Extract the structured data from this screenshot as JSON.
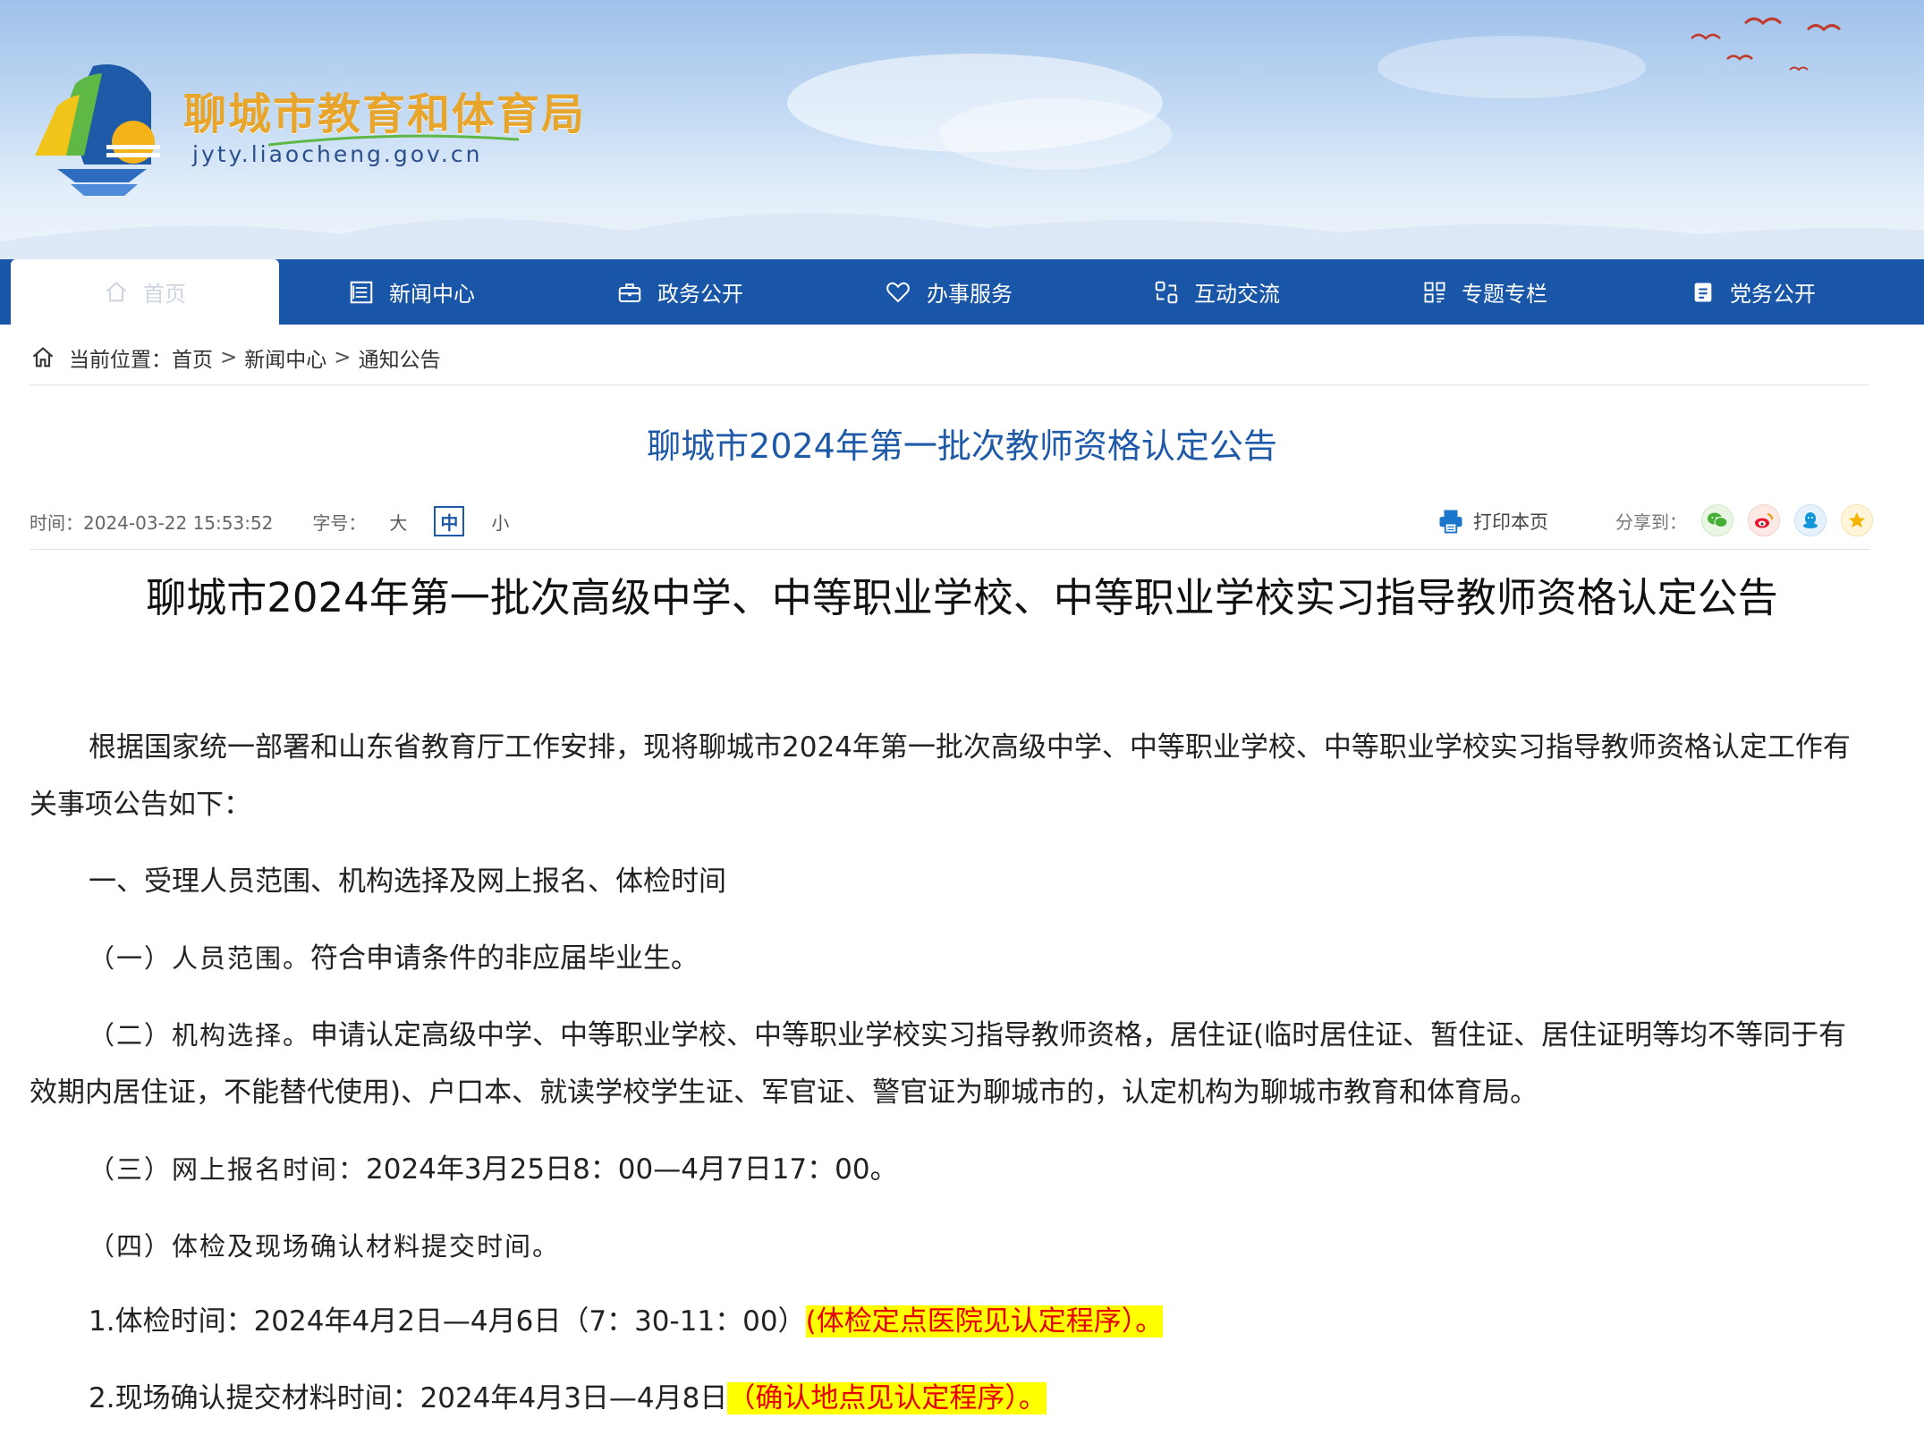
{
  "site": {
    "name": "聊城市教育和体育局",
    "url": "jyty.liaocheng.gov.cn"
  },
  "nav": {
    "items": [
      {
        "label": "首页",
        "icon": "home-icon"
      },
      {
        "label": "新闻中心",
        "icon": "newspaper-icon"
      },
      {
        "label": "政务公开",
        "icon": "briefcase-icon"
      },
      {
        "label": "办事服务",
        "icon": "heart-icon"
      },
      {
        "label": "互动交流",
        "icon": "exchange-icon"
      },
      {
        "label": "专题专栏",
        "icon": "grid-icon"
      },
      {
        "label": "党务公开",
        "icon": "clipboard-icon"
      }
    ],
    "active_index": 0
  },
  "breadcrumb": {
    "label": "当前位置：",
    "items": [
      "首页",
      "新闻中心",
      "通知公告"
    ],
    "separator": ">"
  },
  "page_title": "聊城市2024年第一批次教师资格认定公告",
  "meta": {
    "time": "时间：2024-03-22 15:53:52",
    "font_size_label": "字号：",
    "sizes": [
      "大",
      "中",
      "小"
    ],
    "selected_size": "中",
    "print_label": "打印本页",
    "share_label": "分享到：",
    "share_targets": [
      "wechat-icon",
      "weibo-icon",
      "qq-icon",
      "qzone-icon"
    ]
  },
  "article": {
    "title": "聊城市2024年第一批次高级中学、中等职业学校、中等职业学校实习指导教师资格认定公告",
    "intro": "根据国家统一部署和山东省教育厅工作安排，现将聊城市2024年第一批次高级中学、中等职业学校、中等职业学校实习指导教师资格认定工作有关事项公告如下：",
    "section1": "一、受理人员范围、机构选择及网上报名、体检时间",
    "item1_label": "（一）人员范围。",
    "item1_text": "符合申请条件的非应届毕业生。",
    "item2_label": "（二）机构选择。",
    "item2_text": "申请认定高级中学、中等职业学校、中等职业学校实习指导教师资格，居住证(临时居住证、暂住证、居住证明等均不等同于有效期内居住证，不能替代使用)、户口本、就读学校学生证、军官证、警官证为聊城市的，认定机构为聊城市教育和体育局。",
    "item3_label": "（三）网上报名时间：",
    "item3_text": "2024年3月25日8：00—4月7日17：00。",
    "item4_label": "（四）体检及现场确认材料提交时间。",
    "line1_text": "1.体检时间：2024年4月2日—4月6日（7：30-11：00）",
    "line1_highlight": "(体检定点医院见认定程序）。",
    "line2_text": "2.现场确认提交材料时间：2024年4月3日—4月8日",
    "line2_highlight": "（确认地点见认定程序）。"
  },
  "colors": {
    "nav_bg": "#1a56a8",
    "title_blue": "#1f5aa8",
    "brand_orange": "#e8a52c",
    "highlight_bg": "#ffff00",
    "highlight_text": "#e60000"
  }
}
